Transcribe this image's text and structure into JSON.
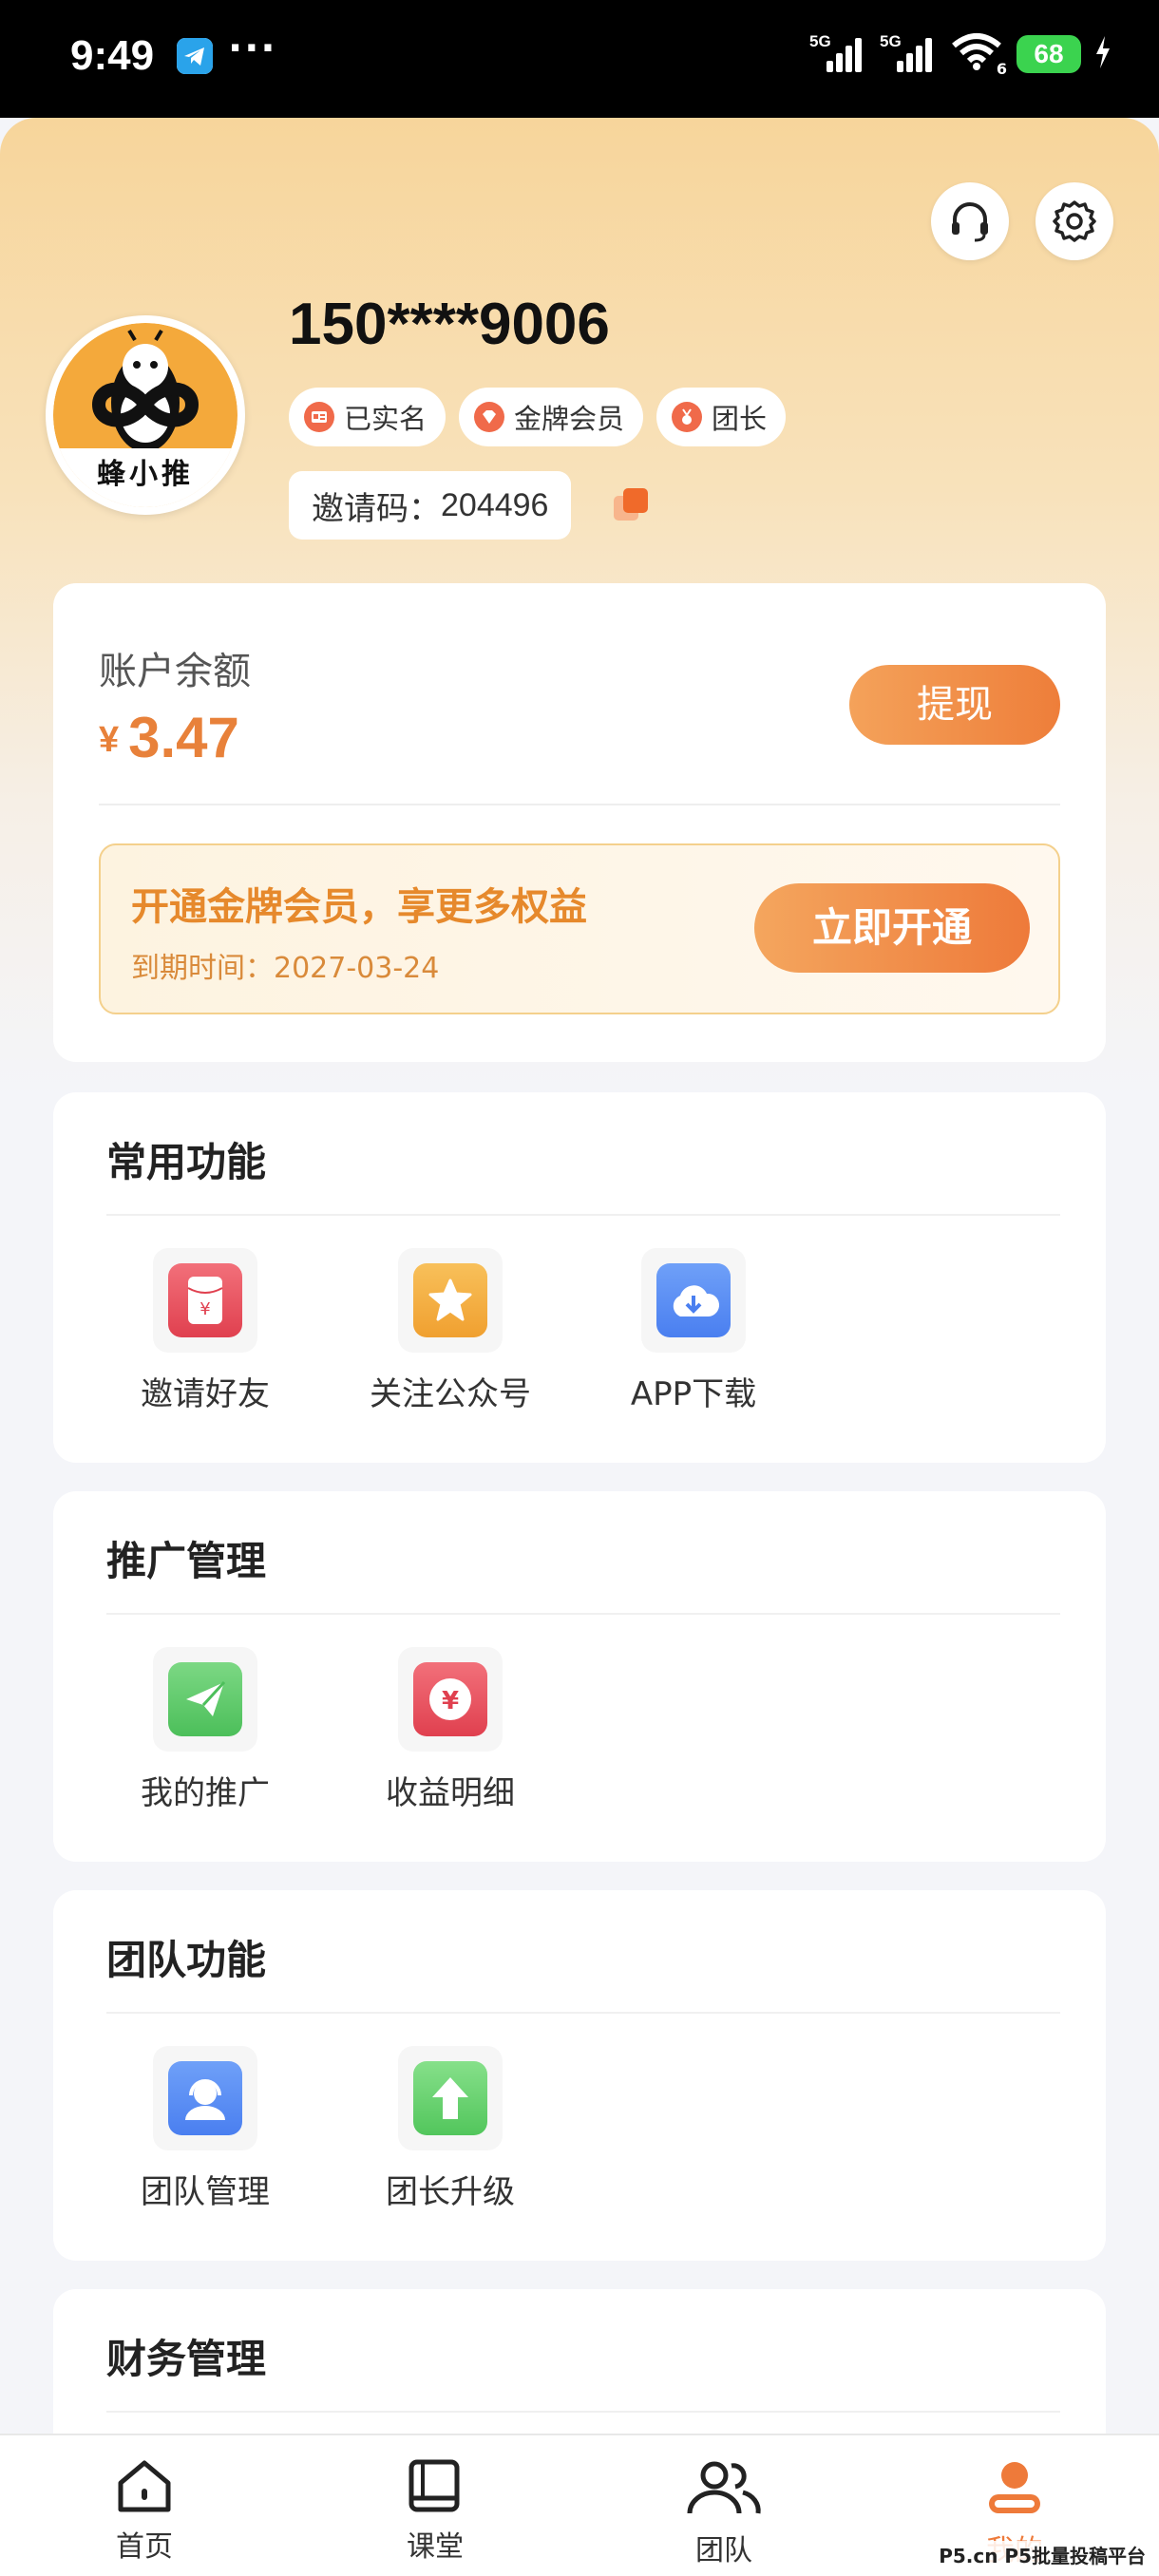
{
  "status_bar": {
    "time": "9:49",
    "more": "···",
    "sim1": "5G",
    "sim2": "5G",
    "wifi_sub": "6",
    "battery": "68"
  },
  "profile": {
    "phone": "150****9006",
    "avatar_brand": "蜂小推",
    "badges": [
      {
        "label": "已实名"
      },
      {
        "label": "金牌会员"
      },
      {
        "label": "团长"
      }
    ],
    "invite_label": "邀请码：",
    "invite_code": "204496"
  },
  "account": {
    "label": "账户余额",
    "currency": "¥",
    "balance": "3.47",
    "withdraw": "提现",
    "vip_title": "开通金牌会员，享更多权益",
    "vip_expire_label": "到期时间：",
    "vip_expire_date": "2027-03-24",
    "vip_button": "立即开通"
  },
  "sections": {
    "common": {
      "title": "常用功能",
      "items": [
        {
          "label": "邀请好友"
        },
        {
          "label": "关注公众号"
        },
        {
          "label": "APP下载"
        }
      ]
    },
    "promo": {
      "title": "推广管理",
      "items": [
        {
          "label": "我的推广"
        },
        {
          "label": "收益明细"
        }
      ]
    },
    "team": {
      "title": "团队功能",
      "items": [
        {
          "label": "团队管理"
        },
        {
          "label": "团长升级"
        }
      ]
    },
    "finance": {
      "title": "财务管理"
    }
  },
  "tabs": [
    {
      "label": "首页"
    },
    {
      "label": "课堂"
    },
    {
      "label": "团队"
    },
    {
      "label": "我的"
    }
  ],
  "watermark": "P5.cn P5批量投稿平台",
  "colors": {
    "accent": "#ee7a3a",
    "gold": "#f4a93b",
    "balance": "#e8813a",
    "battery": "#3bd34f"
  }
}
